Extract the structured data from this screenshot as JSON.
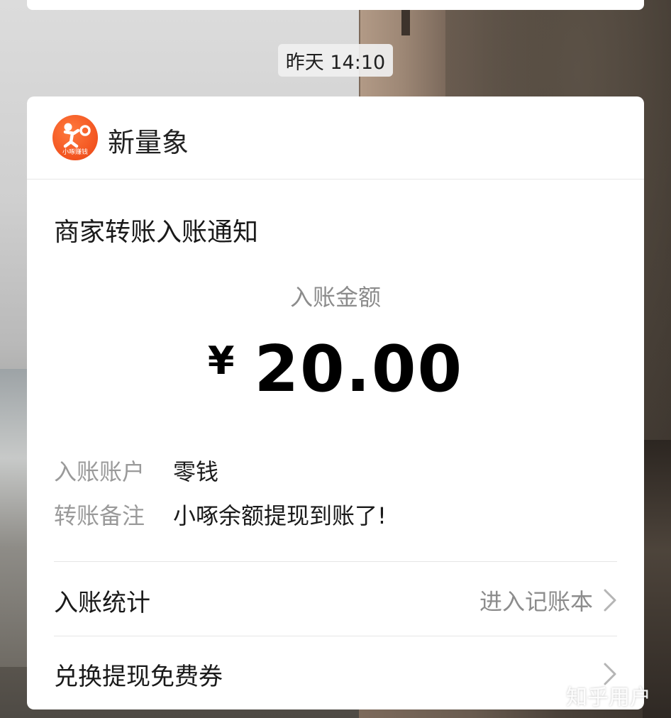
{
  "timestamp": "昨天 14:10",
  "header": {
    "logo_text": "小啄赚钱",
    "brand_name": "新量象"
  },
  "notice": {
    "title": "商家转账入账通知",
    "amount_label": "入账金额",
    "currency_symbol": "¥",
    "amount": "20.00",
    "fields": [
      {
        "key": "入账账户",
        "value": "零钱"
      },
      {
        "key": "转账备注",
        "value": "小啄余额提现到账了!"
      }
    ]
  },
  "rows": [
    {
      "label": "入账统计",
      "hint": "进入记账本"
    },
    {
      "label": "兑换提现免费券",
      "hint": ""
    }
  ],
  "watermark": "知乎用户",
  "colors": {
    "logo_orange": "#f2531f",
    "card_bg": "#ffffff",
    "muted_text": "#8c8c8c"
  },
  "icons": {
    "row_arrow": "chevron-right-icon",
    "logo": "xiaozhuo-logo-icon"
  }
}
